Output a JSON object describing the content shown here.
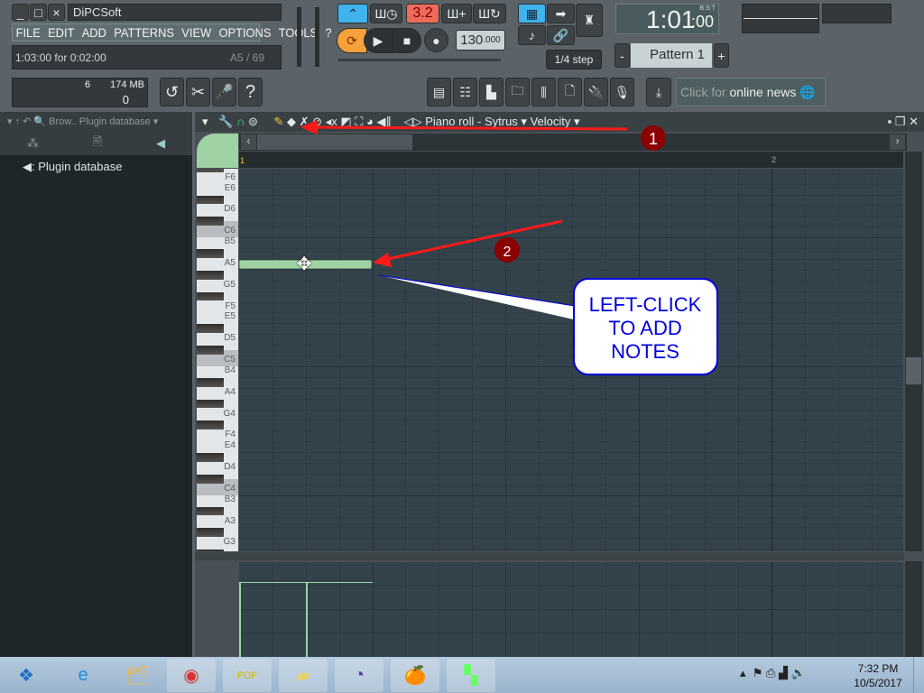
{
  "window": {
    "title": "DiPCSoft",
    "min": "_",
    "max": "□",
    "close": "×"
  },
  "menu": [
    "FILE",
    "EDIT",
    "ADD",
    "PATTERNS",
    "VIEW",
    "OPTIONS",
    "TOOLS",
    "?"
  ],
  "hint": {
    "text": "1:03:00 for 0:02:00",
    "note": "A5 / 69"
  },
  "transport": {
    "pattern_mode_display": "3.2",
    "tempo": "130",
    "tempo_decimals": ".000",
    "time_main": "1:01",
    "time_sub": ":00",
    "time_format": "B:S:T",
    "snap": "1/4 step",
    "pattern": "Pattern 1",
    "pattern_minus": "-",
    "pattern_plus": "+"
  },
  "monitor": {
    "cpu": "6",
    "memory": "174 MB",
    "polyphony": "0"
  },
  "news": {
    "prefix": "Click for ",
    "main": "online news"
  },
  "browser": {
    "title": "Brow.. Plugin database",
    "item": "Plugin database"
  },
  "pianoroll": {
    "title": "Piano roll - Sytrus",
    "target": "Velocity",
    "bar2": "2",
    "bar1": "1"
  },
  "keys": [
    "F6",
    "E6",
    "D6",
    "C6",
    "B5",
    "A5",
    "G5",
    "F5",
    "E5",
    "D5",
    "C5",
    "B4",
    "A4",
    "G4",
    "F4",
    "E4",
    "D4",
    "C4",
    "B3",
    "A3",
    "G3"
  ],
  "note": {
    "pitch": "A5",
    "start_beat": 0,
    "length_beats": 1,
    "color": "#9fd3a6"
  },
  "annotations": {
    "marker1": "1",
    "marker2": "2",
    "callout": "LEFT-CLICK TO ADD NOTES",
    "arrow_color": "#ff1a1a",
    "callout_color": "#0000e0"
  },
  "taskbar": {
    "time": "7:32 PM",
    "date": "10/5/2017",
    "apps": [
      "windows-start",
      "internet-explorer",
      "file-explorer",
      "chrome",
      "pdf-reader",
      "sticky-notes",
      "bittorrent",
      "fl-studio",
      "green-app"
    ]
  }
}
